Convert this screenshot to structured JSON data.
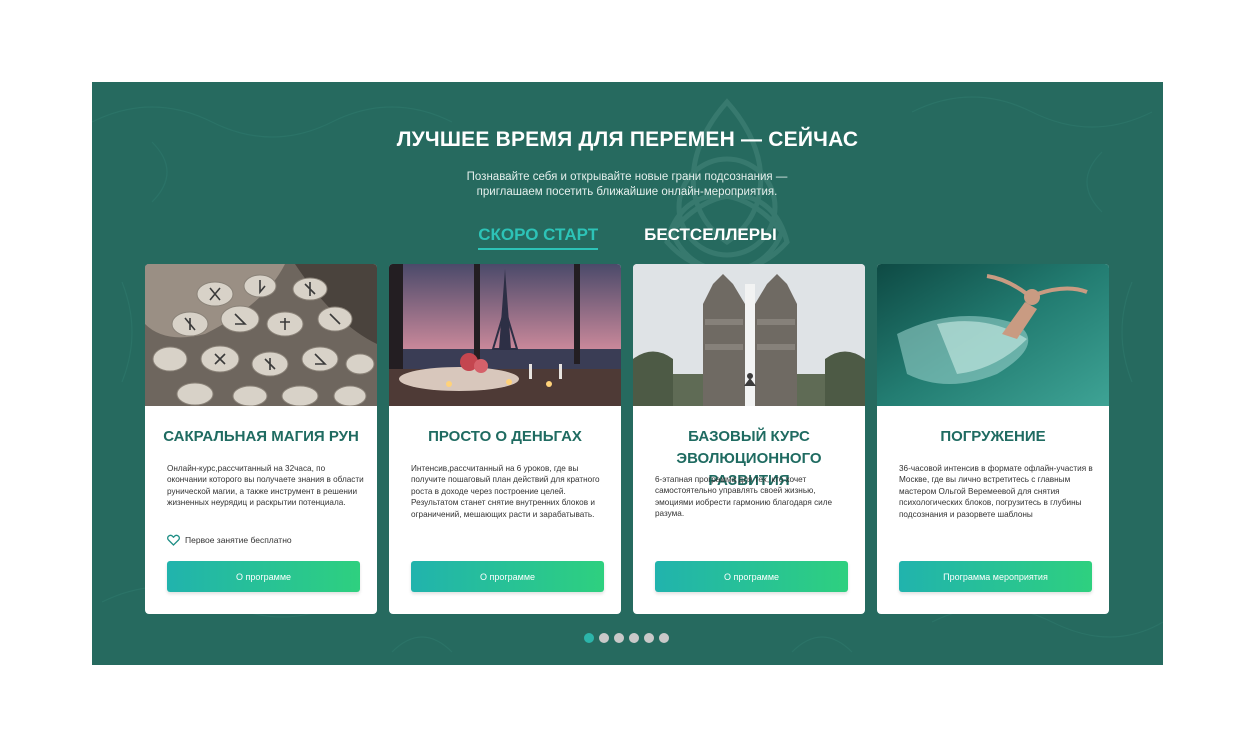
{
  "section": {
    "title": "ЛУЧШЕЕ ВРЕМЯ ДЛЯ ПЕРЕМЕН — СЕЙЧАС",
    "subtitle_line1": "Познавайте себя и открывайте новые грани подсознания —",
    "subtitle_line2": "приглашаем посетить ближайшие онлайн-мероприятия."
  },
  "tabs": [
    {
      "label": "СКОРО СТАРТ",
      "active": true
    },
    {
      "label": "БЕСТСЕЛЛЕРЫ",
      "active": false
    }
  ],
  "cards": [
    {
      "title": "Сакральная магия рун",
      "description": "Онлайн-курс,рассчитанный на 32часа, по окончании которого вы получаете знания в области рунической магии, а также инструмент в решении жизненных неурядиц и раскрытии потенциала.",
      "badge": "Первое занятие бесплатно",
      "button": "О программе",
      "image": "rune-stones-image"
    },
    {
      "title": "Просто о деньгах",
      "description": "Интенсив,рассчитанный на 6 уроков, где вы получите пошаговый план действий для кратного роста в доходе через построение целей. Результатом станет снятие внутренних блоков и ограничений, мешающих расти и зарабатывать.",
      "button": "О программе",
      "image": "eiffel-tower-dinner-image"
    },
    {
      "title": "Базовый курс эволюционного развития",
      "description": "6-этапная программа для тех, кто хочет самостоятельно управлять своей жизнью, эмоциями иобрести гармонию благодаря силе разума.",
      "button": "О программе",
      "image": "bali-temple-gate-image"
    },
    {
      "title": "Погружение",
      "description": "36-часовой интенсив в формате офлайн-участия в Москве, где вы лично встретитесь с главным мастером Ольгой Веремеевой для снятия психологических блоков, погрузитесь в глубины подсознания и разорвете шаблоны",
      "button": "Программа мероприятия",
      "image": "underwater-woman-image"
    }
  ],
  "pagination": {
    "total": 6,
    "active": 1
  },
  "colors": {
    "section_bg": "#266a5f",
    "accent": "#2dc3b7",
    "title_green": "#1f6b61"
  }
}
